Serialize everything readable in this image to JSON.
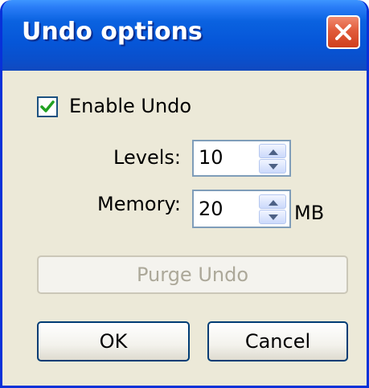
{
  "window": {
    "title": "Undo options"
  },
  "enable_undo": {
    "label": "Enable Undo",
    "checked": true
  },
  "levels": {
    "label": "Levels:",
    "value": "10"
  },
  "memory": {
    "label": "Memory:",
    "value": "20",
    "unit": "MB"
  },
  "buttons": {
    "purge": "Purge Undo",
    "ok": "OK",
    "cancel": "Cancel"
  },
  "icons": {
    "close": "close-icon",
    "check": "checkmark-icon",
    "up": "arrow-up-icon",
    "down": "arrow-down-icon"
  },
  "colors": {
    "titlebar": "#0656d8",
    "frame": "#0831d9",
    "dialog_bg": "#ece9d8",
    "close_button": "#e15b3a",
    "checkmark": "#21a121"
  }
}
